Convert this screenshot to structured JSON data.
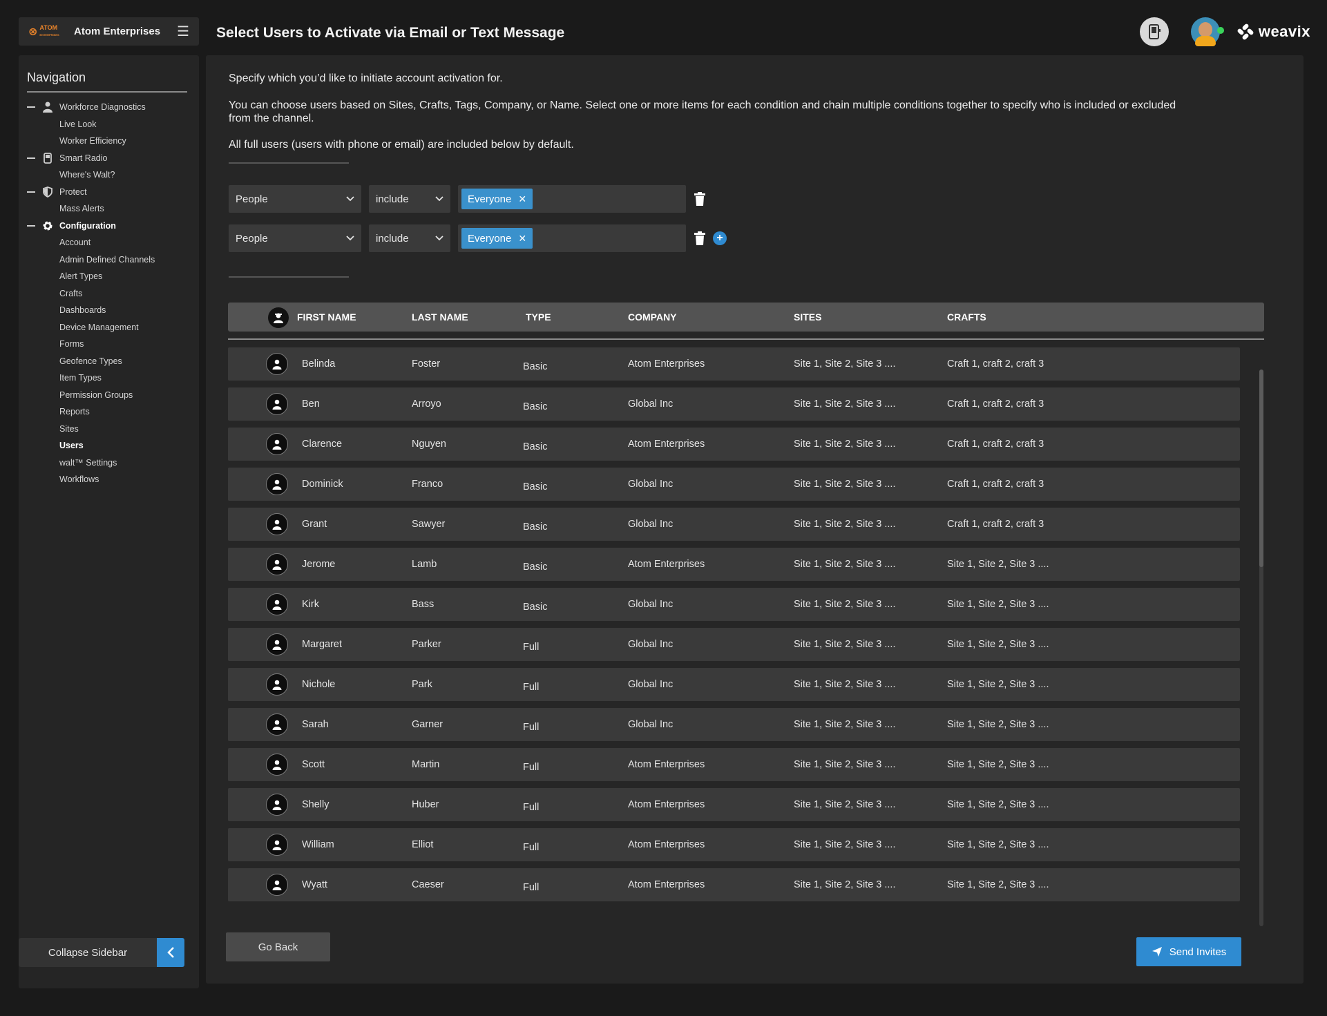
{
  "brand": {
    "logo_text": "ATOM",
    "logo_subtext": "ENTERPRISES",
    "org_name": "Atom Enterprises",
    "menu_icon": "hamburger-icon"
  },
  "header": {
    "title": "Select Users to Activate via Email or Text Message",
    "device_icon": "mobile-device-icon",
    "avatar_status": "online",
    "product_logo": "weavix"
  },
  "sidebar": {
    "heading": "Navigation",
    "items": [
      {
        "label": "Workforce Diagnostics",
        "kind": "group",
        "icon": "person-icon"
      },
      {
        "label": "Live Look",
        "kind": "child"
      },
      {
        "label": "Worker Efficiency",
        "kind": "child"
      },
      {
        "label": "Smart Radio",
        "kind": "group",
        "icon": "radio-icon"
      },
      {
        "label": "Where's Walt?",
        "kind": "child"
      },
      {
        "label": "Protect",
        "kind": "group",
        "icon": "shield-icon"
      },
      {
        "label": "Mass Alerts",
        "kind": "child"
      },
      {
        "label": "Configuration",
        "kind": "group",
        "icon": "gear-icon",
        "active": true
      },
      {
        "label": "Account",
        "kind": "child"
      },
      {
        "label": "Admin Defined Channels",
        "kind": "child"
      },
      {
        "label": "Alert Types",
        "kind": "child"
      },
      {
        "label": "Crafts",
        "kind": "child"
      },
      {
        "label": "Dashboards",
        "kind": "child"
      },
      {
        "label": "Device Management",
        "kind": "child"
      },
      {
        "label": "Forms",
        "kind": "child"
      },
      {
        "label": "Geofence Types",
        "kind": "child"
      },
      {
        "label": "Item Types",
        "kind": "child"
      },
      {
        "label": "Permission Groups",
        "kind": "child"
      },
      {
        "label": "Reports",
        "kind": "child"
      },
      {
        "label": "Sites",
        "kind": "child"
      },
      {
        "label": "Users",
        "kind": "child",
        "active": true
      },
      {
        "label": "walt™ Settings",
        "kind": "child"
      },
      {
        "label": "Workflows",
        "kind": "child"
      }
    ],
    "collapse_label": "Collapse Sidebar"
  },
  "main": {
    "description_1": "Specify which you’d like to initiate account activation for.",
    "description_2": "You can choose users based on Sites, Crafts, Tags, Company, or Name. Select one or more items for each condition and chain multiple conditions together to specify who is included or excluded from the channel.",
    "description_3": "All full users (users with phone or email) are included below by default.",
    "filters": [
      {
        "field": "People",
        "mode": "include",
        "tag": "Everyone"
      },
      {
        "field": "People",
        "mode": "include",
        "tag": "Everyone"
      }
    ]
  },
  "table": {
    "columns": [
      "FIRST NAME",
      "LAST NAME",
      "TYPE",
      "COMPANY",
      "SITES",
      "CRAFTS"
    ],
    "rows": [
      {
        "first": "Belinda",
        "last": "Foster",
        "type": "Basic",
        "company": "Atom Enterprises",
        "sites": "Site 1, Site 2, Site 3 ....",
        "crafts": "Craft 1, craft 2, craft 3"
      },
      {
        "first": "Ben",
        "last": "Arroyo",
        "type": "Basic",
        "company": "Global Inc",
        "sites": "Site 1, Site 2, Site 3 ....",
        "crafts": "Craft 1, craft 2, craft 3"
      },
      {
        "first": "Clarence",
        "last": "Nguyen",
        "type": "Basic",
        "company": "Atom Enterprises",
        "sites": "Site 1, Site 2, Site 3 ....",
        "crafts": "Craft 1, craft 2, craft 3"
      },
      {
        "first": "Dominick",
        "last": "Franco",
        "type": "Basic",
        "company": "Global Inc",
        "sites": "Site 1, Site 2, Site 3 ....",
        "crafts": "Craft 1, craft 2, craft 3"
      },
      {
        "first": "Grant",
        "last": "Sawyer",
        "type": "Basic",
        "company": "Global Inc",
        "sites": "Site 1, Site 2, Site 3 ....",
        "crafts": "Craft 1, craft 2, craft 3"
      },
      {
        "first": "Jerome",
        "last": "Lamb",
        "type": "Basic",
        "company": "Atom Enterprises",
        "sites": "Site 1, Site 2, Site 3 ....",
        "crafts": "Site 1, Site 2, Site 3 ...."
      },
      {
        "first": "Kirk",
        "last": "Bass",
        "type": "Basic",
        "company": "Global Inc",
        "sites": "Site 1, Site 2, Site 3 ....",
        "crafts": "Site 1, Site 2, Site 3 ...."
      },
      {
        "first": "Margaret",
        "last": "Parker",
        "type": "Full",
        "company": "Global Inc",
        "sites": "Site 1, Site 2, Site 3 ....",
        "crafts": "Site 1, Site 2, Site 3 ...."
      },
      {
        "first": "Nichole",
        "last": "Park",
        "type": "Full",
        "company": "Global Inc",
        "sites": "Site 1, Site 2, Site 3 ....",
        "crafts": "Site 1, Site 2, Site 3 ...."
      },
      {
        "first": "Sarah",
        "last": "Garner",
        "type": "Full",
        "company": "Global Inc",
        "sites": "Site 1, Site 2, Site 3 ....",
        "crafts": "Site 1, Site 2, Site 3 ...."
      },
      {
        "first": "Scott",
        "last": "Martin",
        "type": "Full",
        "company": "Atom Enterprises",
        "sites": "Site 1, Site 2, Site 3 ....",
        "crafts": "Site 1, Site 2, Site 3 ...."
      },
      {
        "first": "Shelly",
        "last": "Huber",
        "type": "Full",
        "company": "Atom Enterprises",
        "sites": "Site 1, Site 2, Site 3 ....",
        "crafts": "Site 1, Site 2, Site 3 ...."
      },
      {
        "first": "William",
        "last": "Elliot",
        "type": "Full",
        "company": "Atom Enterprises",
        "sites": "Site 1, Site 2, Site 3 ....",
        "crafts": "Site 1, Site 2, Site 3 ...."
      },
      {
        "first": "Wyatt",
        "last": "Caeser",
        "type": "Full",
        "company": "Atom Enterprises",
        "sites": "Site 1, Site 2, Site 3 ....",
        "crafts": "Site 1, Site 2, Site 3 ...."
      }
    ]
  },
  "footer": {
    "back_label": "Go Back",
    "send_label": "Send Invites"
  },
  "colors": {
    "accent": "#2f8bd1",
    "brand_orange": "#e8832a",
    "background": "#1a1a1a",
    "panel": "#262626",
    "row": "#3a3a3a"
  }
}
